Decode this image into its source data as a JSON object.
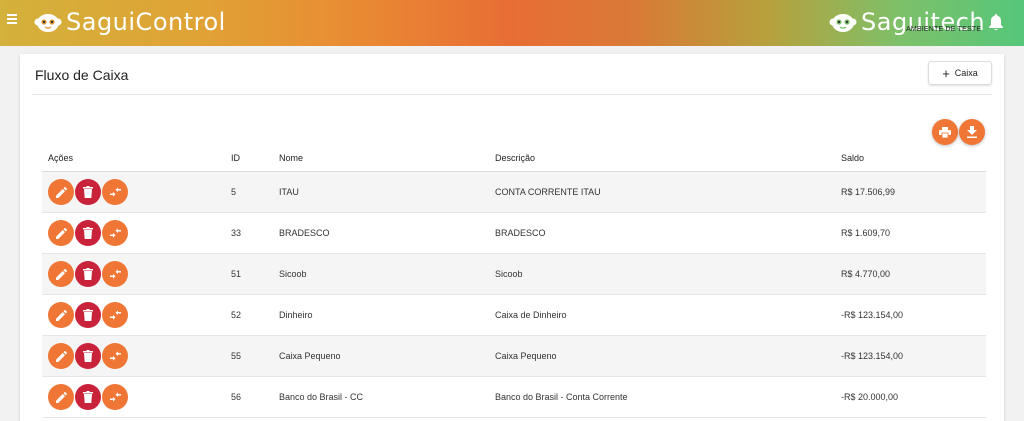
{
  "header": {
    "app_title": "SaguiControl",
    "brand_right": "Saguitech",
    "env_label": "AMBIENTE DE TESTE",
    "colors": {
      "accent": "#f07636",
      "danger": "#c8233a"
    }
  },
  "card": {
    "title": "Fluxo de Caixa",
    "add_button_label": "Caixa"
  },
  "table": {
    "columns": {
      "acoes": "Ações",
      "id": "ID",
      "nome": "Nome",
      "descricao": "Descrição",
      "saldo": "Saldo"
    },
    "rows": [
      {
        "id": "5",
        "nome": "ITAU",
        "descricao": "CONTA CORRENTE ITAU",
        "saldo": "R$ 17.506,99"
      },
      {
        "id": "33",
        "nome": "BRADESCO",
        "descricao": "BRADESCO",
        "saldo": "R$ 1.609,70"
      },
      {
        "id": "51",
        "nome": "Sicoob",
        "descricao": "Sicoob",
        "saldo": "R$ 4.770,00"
      },
      {
        "id": "52",
        "nome": "Dinheiro",
        "descricao": "Caixa de Dinheiro",
        "saldo": "-R$ 123.154,00"
      },
      {
        "id": "55",
        "nome": "Caixa Pequeno",
        "descricao": "Caixa Pequeno",
        "saldo": "-R$ 123.154,00"
      },
      {
        "id": "56",
        "nome": "Banco do Brasil - CC",
        "descricao": "Banco do Brasil - Conta Corrente",
        "saldo": "-R$ 20.000,00"
      }
    ]
  },
  "icons": {
    "menu": "menu-icon",
    "logo": "monkey-icon",
    "bell": "bell-icon",
    "print": "print-icon",
    "download": "download-icon",
    "edit": "pencil-icon",
    "delete": "trash-icon",
    "transfer": "transfer-icon"
  }
}
